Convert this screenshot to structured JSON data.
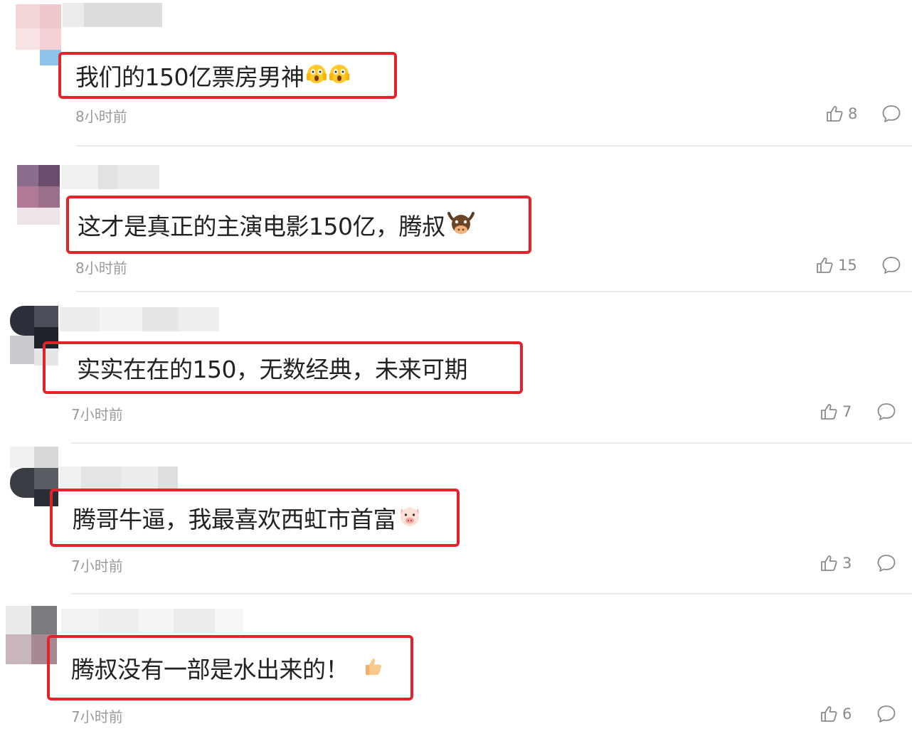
{
  "comments": [
    {
      "text": "我们的150亿票房男神",
      "emoji": [
        "scream-emoji",
        "scream-emoji"
      ],
      "time": "8小时前",
      "likes": "8"
    },
    {
      "text": "这才是真正的主演电影150亿，腾叔",
      "emoji": [
        "bull-emoji"
      ],
      "time": "8小时前",
      "likes": "15"
    },
    {
      "text": "实实在在的150，无数经典，未来可期",
      "emoji": [],
      "time": "7小时前",
      "likes": "7"
    },
    {
      "text": "腾哥牛逼，我最喜欢西虹市首富",
      "emoji": [
        "pig-emoji"
      ],
      "time": "7小时前",
      "likes": "3"
    },
    {
      "text": "腾叔没有一部是水出来的！",
      "emoji": [
        "thumbs-up-emoji"
      ],
      "time": "7小时前",
      "likes": "6"
    }
  ],
  "colors": {
    "highlight_border": "#e2232a",
    "text": "#222222",
    "meta": "#9a9a9a"
  }
}
